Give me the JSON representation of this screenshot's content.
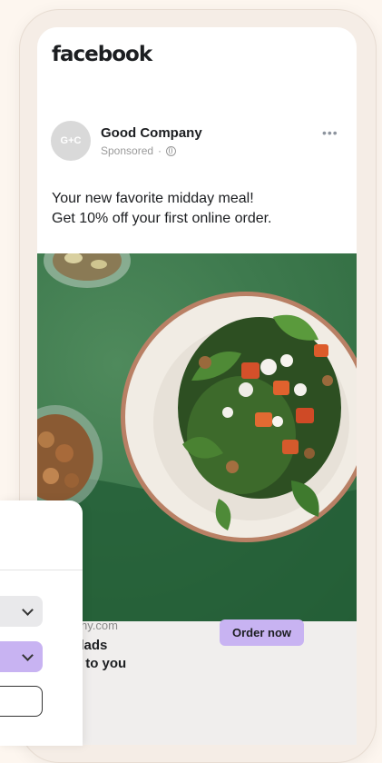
{
  "app": {
    "logo_text": "facebook"
  },
  "post": {
    "avatar_initials": "G+C",
    "page_name": "Good Company",
    "sponsored_label": "Sponsored",
    "separator": "·",
    "more_icon": "more-dots-icon",
    "text_lines": [
      "Your new favorite midday meal!",
      "Get 10% off your first online order."
    ]
  },
  "cta": {
    "domain": "company.com",
    "headline_lines": [
      "sh salads",
      "vered to you"
    ],
    "button_label": "Order now"
  },
  "panel": {
    "select_icon": "chevron-down-icon"
  },
  "colors": {
    "accent": "#c8b3f2",
    "text": "#1c1e21",
    "muted": "#9a9a9a",
    "image_green": "#3e7a4e"
  }
}
